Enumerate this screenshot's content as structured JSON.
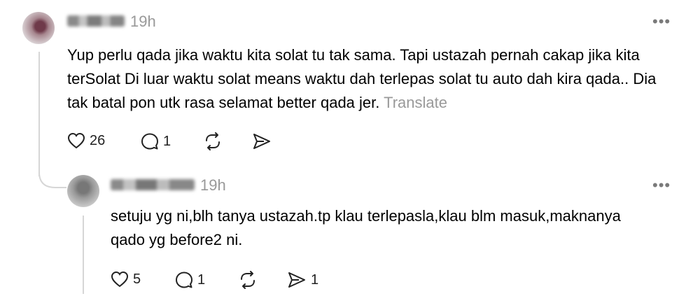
{
  "comment": {
    "time": "19h",
    "more": "•••",
    "body": "Yup perlu qada jika waktu kita solat tu tak sama. Tapi ustazah pernah cakap jika kita terSolat Di luar waktu solat means waktu dah terlepas solat tu auto dah kira qada.. Dia tak batal pon utk rasa selamat better qada jer.",
    "translate": "Translate",
    "likes": "26",
    "replies": "1"
  },
  "reply": {
    "time": "19h",
    "more": "•••",
    "body": "setuju yg ni,blh tanya ustazah.tp klau terlepasla,klau blm masuk,maknanya qado yg before2 ni.",
    "likes": "5",
    "replies": "1",
    "shares": "1"
  },
  "icons": {
    "like": "heart-icon",
    "reply": "comment-bubble-icon",
    "repost": "repost-icon",
    "share": "send-icon"
  }
}
